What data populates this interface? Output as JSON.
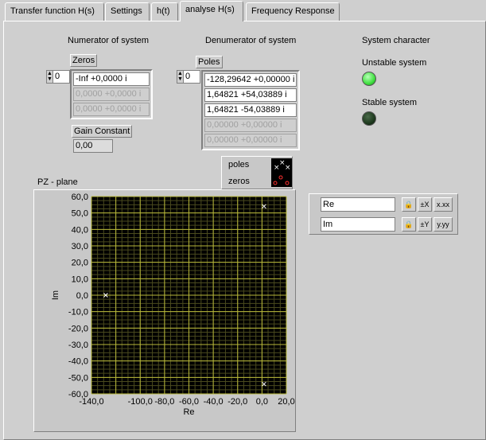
{
  "tabs": [
    {
      "label": "Transfer function H(s)",
      "active": false
    },
    {
      "label": "Settings",
      "active": false
    },
    {
      "label": "h(t)",
      "active": false
    },
    {
      "label": "analyse H(s)",
      "active": true
    },
    {
      "label": "Frequency Response",
      "active": false
    }
  ],
  "numerator": {
    "title": "Numerator of system",
    "zeros_label": "Zeros",
    "index": "0",
    "zeros": [
      "-Inf +0,0000 i",
      "0,0000 +0,0000 i",
      "0,0000 +0,0000 i"
    ],
    "gain_label": "Gain Constant",
    "gain_value": "0,00"
  },
  "denominator": {
    "title": "Denumerator of system",
    "poles_label": "Poles",
    "index": "0",
    "poles": [
      "-128,29642 +0,00000 i",
      "1,64821 +54,03889 i",
      "1,64821 -54,03889 i",
      "0,00000 +0,00000 i",
      "0,00000 +0,00000 i"
    ]
  },
  "character": {
    "title": "System character",
    "unstable_label": "Unstable system",
    "stable_label": "Stable system",
    "unstable_color": "#40e040",
    "stable_color": "#1e3a1e"
  },
  "legend": {
    "poles": "poles",
    "zeros": "zeros"
  },
  "scale": {
    "x_name": "Re",
    "y_name": "Im"
  },
  "chart_data": {
    "type": "scatter",
    "title": "PZ - plane",
    "xlabel": "Re",
    "ylabel": "Im",
    "xlim": [
      -140,
      20
    ],
    "ylim": [
      -60,
      60
    ],
    "x_ticks": [
      -140,
      -120,
      -100,
      -80,
      -60,
      -40,
      -20,
      0,
      20
    ],
    "x_tick_labels": [
      "-140,0",
      "",
      "-100,0",
      "-80,0",
      "-60,0",
      "-40,0",
      "-20,0",
      "0,0",
      "20,0"
    ],
    "y_ticks": [
      60,
      50,
      40,
      30,
      20,
      10,
      0,
      -10,
      -20,
      -30,
      -40,
      -50,
      -60
    ],
    "y_tick_labels": [
      "60,0",
      "50,0",
      "40,0",
      "30,0",
      "20,0",
      "10,0",
      "0,0",
      "-10,0",
      "-20,0",
      "-30,0",
      "-40,0",
      "-50,0",
      "-60,0"
    ],
    "grid": true,
    "series": [
      {
        "name": "poles",
        "marker": "x",
        "color": "#ffffff",
        "points": [
          [
            -128.3,
            0
          ],
          [
            1.65,
            54.04
          ],
          [
            1.65,
            -54.04
          ]
        ]
      },
      {
        "name": "zeros",
        "marker": "o",
        "color": "#ff3030",
        "points": []
      }
    ]
  }
}
